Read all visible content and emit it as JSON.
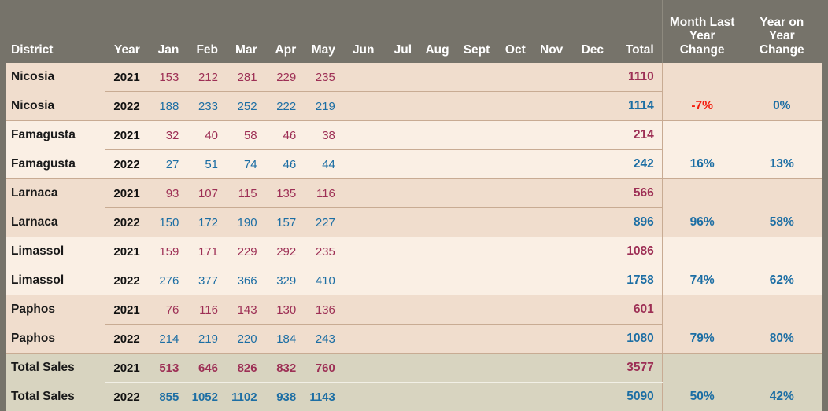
{
  "table": {
    "headers": {
      "district": "District",
      "year": "Year",
      "months": [
        "Jan",
        "Feb",
        "Mar",
        "Apr",
        "May",
        "Jun",
        "Jul",
        "Aug",
        "Sept",
        "Oct",
        "Nov",
        "Dec"
      ],
      "total": "Total",
      "month_last_year_change": "Month Last Year Change",
      "year_on_year_change": "Year on Year Change"
    },
    "colors": {
      "header_background": "#76736a",
      "header_text": "#ffffff",
      "band_a": "#f0ddcd",
      "band_b": "#faefe4",
      "total_band": "#d8d4c0",
      "value_2021": "#9d2f55",
      "value_2022": "#1c6ea4",
      "change_negative": "#f41b0c",
      "change_positive": "#1c6ea4",
      "gridline": "#c8ab93"
    },
    "groups": [
      {
        "district": "Nicosia",
        "rows": [
          {
            "year": "2021",
            "months": [
              "153",
              "212",
              "281",
              "229",
              "235",
              "",
              "",
              "",
              "",
              "",
              "",
              ""
            ],
            "total": "1110",
            "month_last_year_change": "",
            "year_on_year_change": ""
          },
          {
            "year": "2022",
            "months": [
              "188",
              "233",
              "252",
              "222",
              "219",
              "",
              "",
              "",
              "",
              "",
              "",
              ""
            ],
            "total": "1114",
            "month_last_year_change": "-7%",
            "year_on_year_change": "0%"
          }
        ]
      },
      {
        "district": "Famagusta",
        "rows": [
          {
            "year": "2021",
            "months": [
              "32",
              "40",
              "58",
              "46",
              "38",
              "",
              "",
              "",
              "",
              "",
              "",
              ""
            ],
            "total": "214",
            "month_last_year_change": "",
            "year_on_year_change": ""
          },
          {
            "year": "2022",
            "months": [
              "27",
              "51",
              "74",
              "46",
              "44",
              "",
              "",
              "",
              "",
              "",
              "",
              ""
            ],
            "total": "242",
            "month_last_year_change": "16%",
            "year_on_year_change": "13%"
          }
        ]
      },
      {
        "district": "Larnaca",
        "rows": [
          {
            "year": "2021",
            "months": [
              "93",
              "107",
              "115",
              "135",
              "116",
              "",
              "",
              "",
              "",
              "",
              "",
              ""
            ],
            "total": "566",
            "month_last_year_change": "",
            "year_on_year_change": ""
          },
          {
            "year": "2022",
            "months": [
              "150",
              "172",
              "190",
              "157",
              "227",
              "",
              "",
              "",
              "",
              "",
              "",
              ""
            ],
            "total": "896",
            "month_last_year_change": "96%",
            "year_on_year_change": "58%"
          }
        ]
      },
      {
        "district": "Limassol",
        "rows": [
          {
            "year": "2021",
            "months": [
              "159",
              "171",
              "229",
              "292",
              "235",
              "",
              "",
              "",
              "",
              "",
              "",
              ""
            ],
            "total": "1086",
            "month_last_year_change": "",
            "year_on_year_change": ""
          },
          {
            "year": "2022",
            "months": [
              "276",
              "377",
              "366",
              "329",
              "410",
              "",
              "",
              "",
              "",
              "",
              "",
              ""
            ],
            "total": "1758",
            "month_last_year_change": "74%",
            "year_on_year_change": "62%"
          }
        ]
      },
      {
        "district": "Paphos",
        "rows": [
          {
            "year": "2021",
            "months": [
              "76",
              "116",
              "143",
              "130",
              "136",
              "",
              "",
              "",
              "",
              "",
              "",
              ""
            ],
            "total": "601",
            "month_last_year_change": "",
            "year_on_year_change": ""
          },
          {
            "year": "2022",
            "months": [
              "214",
              "219",
              "220",
              "184",
              "243",
              "",
              "",
              "",
              "",
              "",
              "",
              ""
            ],
            "total": "1080",
            "month_last_year_change": "79%",
            "year_on_year_change": "80%"
          }
        ]
      },
      {
        "district": "Total Sales",
        "is_total": true,
        "rows": [
          {
            "year": "2021",
            "months": [
              "513",
              "646",
              "826",
              "832",
              "760",
              "",
              "",
              "",
              "",
              "",
              "",
              ""
            ],
            "total": "3577",
            "month_last_year_change": "",
            "year_on_year_change": ""
          },
          {
            "year": "2022",
            "months": [
              "855",
              "1052",
              "1102",
              "938",
              "1143",
              "",
              "",
              "",
              "",
              "",
              "",
              ""
            ],
            "total": "5090",
            "month_last_year_change": "50%",
            "year_on_year_change": "42%"
          }
        ]
      }
    ]
  }
}
